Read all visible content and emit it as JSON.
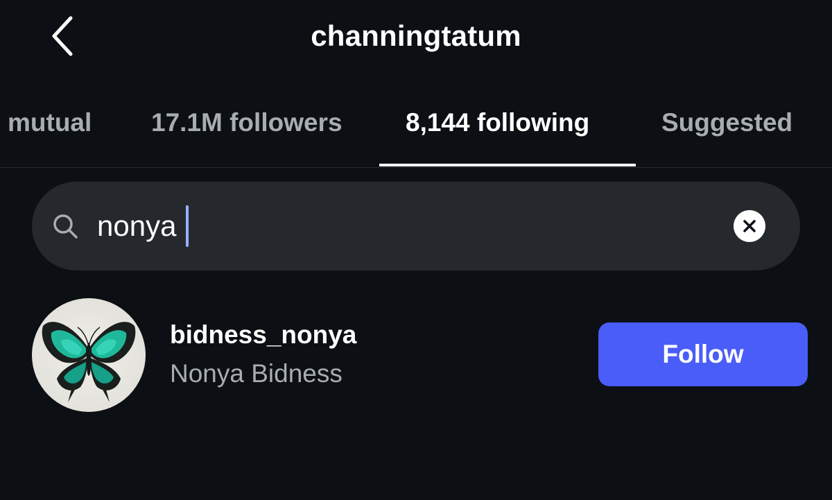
{
  "header": {
    "title": "channingtatum",
    "back_icon": "chevron-left-icon"
  },
  "tabs": [
    {
      "label": "mutual",
      "active": false
    },
    {
      "label": "17.1M followers",
      "active": false
    },
    {
      "label": "8,144 following",
      "active": true
    },
    {
      "label": "Suggested",
      "active": false
    }
  ],
  "search": {
    "value": "nonya",
    "icon": "search-icon",
    "clear_icon": "clear-icon"
  },
  "results": [
    {
      "username": "bidness_nonya",
      "full_name": "Nonya Bidness",
      "avatar": "butterfly-avatar",
      "action_label": "Follow"
    }
  ],
  "colors": {
    "background": "#0c1014",
    "search_bg": "#25292e",
    "secondary_text": "#a8acb3",
    "follow_button": "#4a5df9"
  }
}
